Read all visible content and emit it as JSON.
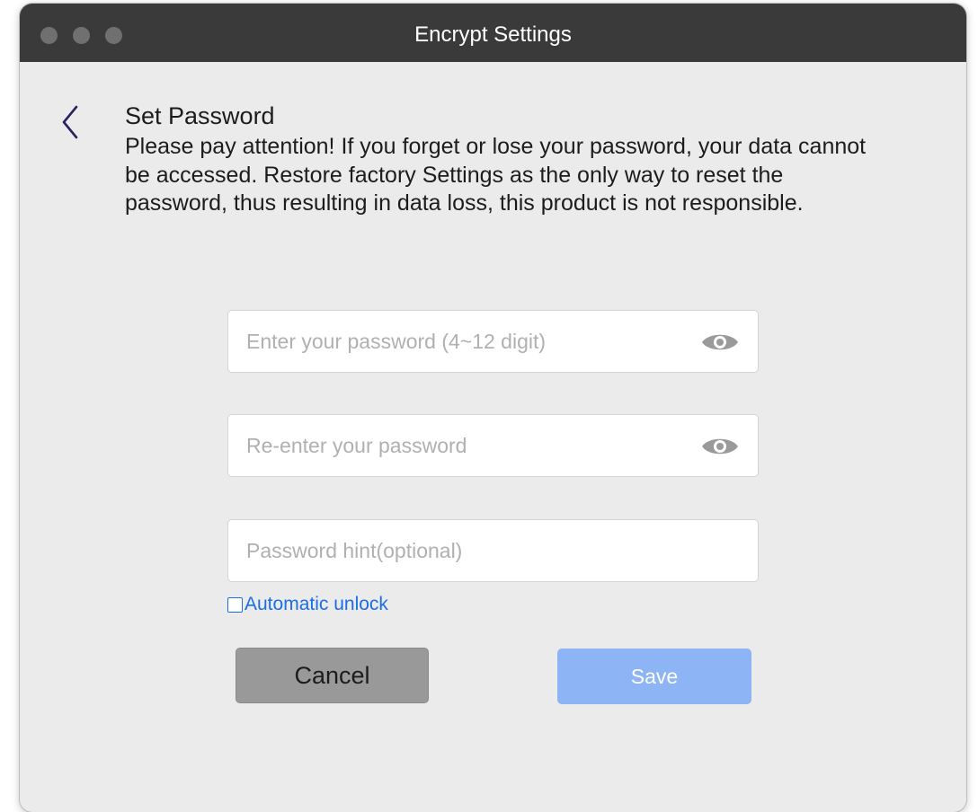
{
  "window": {
    "title": "Encrypt Settings"
  },
  "content": {
    "heading": "Set Password",
    "warning": "Please pay attention! If you forget or lose your password, your data cannot be accessed. Restore factory Settings as the only way to reset the password, thus resulting in data loss, this product is not responsible."
  },
  "form": {
    "password_placeholder": "Enter your password (4~12 digit)",
    "confirm_placeholder": "Re-enter your password",
    "hint_placeholder": "Password hint(optional)",
    "auto_unlock_label": "Automatic unlock",
    "auto_unlock_checked": false
  },
  "buttons": {
    "cancel_label": "Cancel",
    "save_label": "Save"
  },
  "icons": {
    "back": "chevron-left-icon",
    "reveal": "eye-icon"
  },
  "colors": {
    "titlebar": "#3a3a3a",
    "accent": "#1a6ee8",
    "save_button": "#8db5f5",
    "cancel_button": "#999999"
  }
}
